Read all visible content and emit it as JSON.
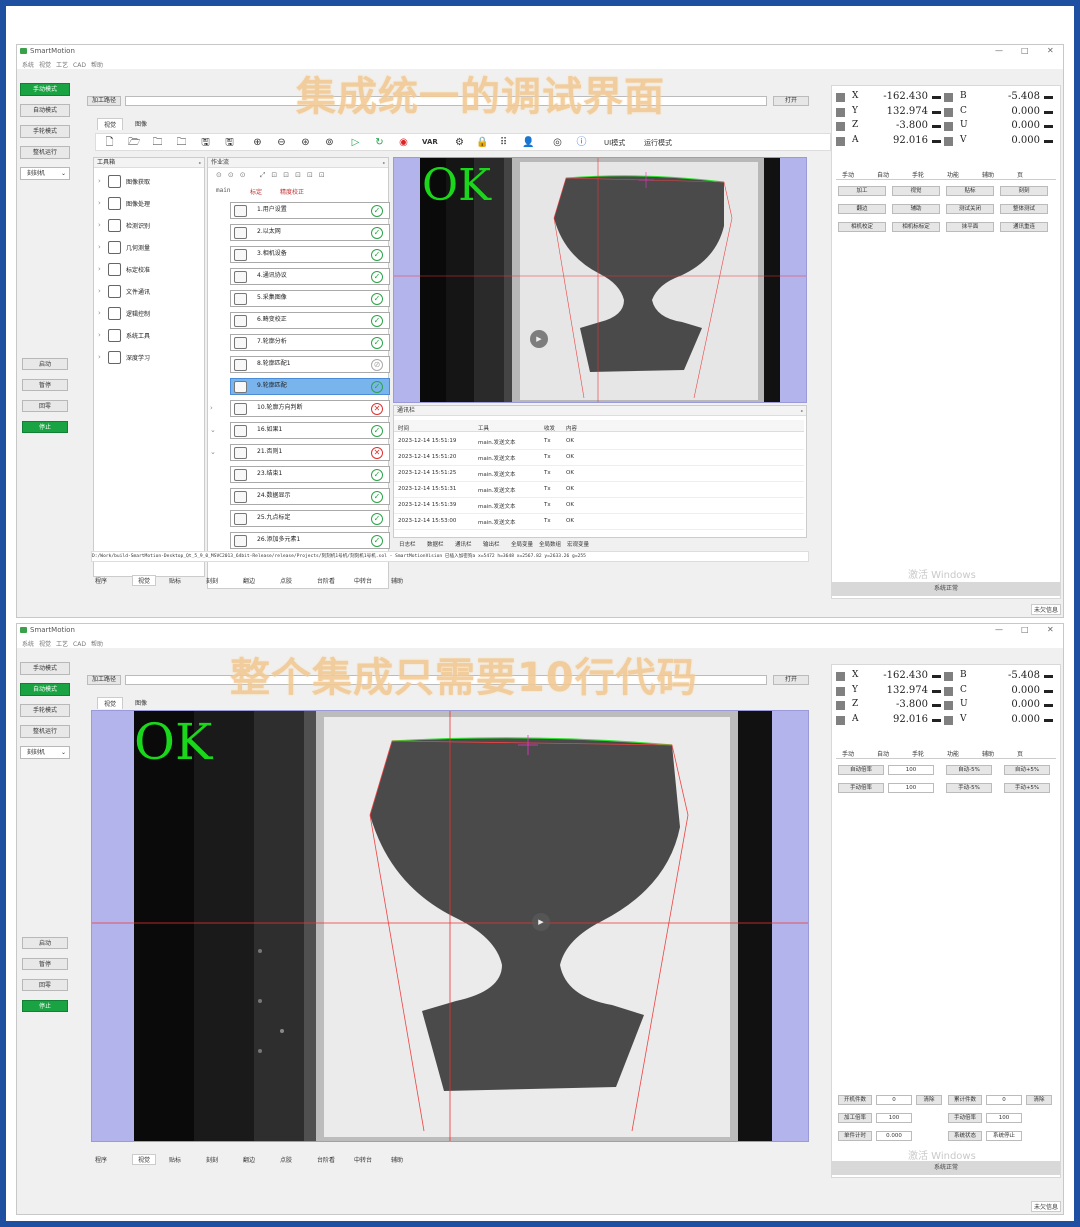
{
  "app": {
    "title": "SmartMotion",
    "controls": [
      "—",
      "□",
      "✕"
    ]
  },
  "menu": [
    "系统",
    "视觉",
    "工艺",
    "CAD",
    "帮助"
  ],
  "banners": [
    "集成统一的调试界面",
    "整个集成只需要10行代码"
  ],
  "leftbar": {
    "modes": [
      "手动模式",
      "自动模式",
      "手轮模式",
      "整机运行"
    ],
    "machine_select": "刻刻机",
    "actions": [
      "启动",
      "暂停",
      "回零",
      "停止"
    ]
  },
  "path_row": {
    "label": "加工路径",
    "value": "",
    "open_button": "打开"
  },
  "view_tabs": [
    "视觉",
    "图像"
  ],
  "toolbar": {
    "icons": [
      "new-icon",
      "open-icon",
      "open-folder-icon",
      "open-recent-icon",
      "save-icon",
      "save-as-icon",
      "zoom-in-icon",
      "zoom-out-icon",
      "zoom-fit-icon",
      "zoom-reset-icon",
      "run-once-icon",
      "run-loop-icon",
      "stop-icon"
    ],
    "var_label": "VAR",
    "icons2": [
      "settings-icon",
      "lock-icon",
      "grid-icon",
      "user-icon",
      "camera-icon",
      "info-icon"
    ],
    "ui_mode": "UI模式",
    "run_mode": "运行模式"
  },
  "toolbox": {
    "title": "工具箱",
    "items": [
      "图像获取",
      "图像处理",
      "检测识别",
      "几何测量",
      "标定校准",
      "文件通讯",
      "逻辑控制",
      "系统工具",
      "深度学习"
    ]
  },
  "flow": {
    "title": "作业流",
    "tabs": [
      "main",
      "标定",
      "精度校正"
    ],
    "items": [
      {
        "label": "1.用户设置",
        "icon": "user-set-icon",
        "status": "ok"
      },
      {
        "label": "2.以太网",
        "icon": "ethernet-icon",
        "status": "ok"
      },
      {
        "label": "3.相机设备",
        "icon": "camera-device-icon",
        "status": "ok"
      },
      {
        "label": "4.通讯协议",
        "icon": "protocol-icon",
        "status": "ok"
      },
      {
        "label": "5.采集图像",
        "icon": "capture-icon",
        "status": "ok"
      },
      {
        "label": "6.畸变校正",
        "icon": "distortion-icon",
        "status": "ok"
      },
      {
        "label": "7.轮廓分析",
        "icon": "contour-icon",
        "status": "ok"
      },
      {
        "label": "8.轮廓匹配1",
        "icon": "match-icon",
        "status": "off"
      },
      {
        "label": "9.轮廓匹配",
        "icon": "match-icon",
        "status": "ok"
      },
      {
        "label": "10.轮廓方向判断",
        "icon": "folder-icon",
        "status": "err"
      },
      {
        "label": "16.如果1",
        "icon": "if-icon",
        "status": "ok"
      },
      {
        "label": "21.否则1",
        "icon": "else-icon",
        "status": "err"
      },
      {
        "label": "23.结束1",
        "icon": "end-icon",
        "status": "ok"
      },
      {
        "label": "24.数据显示",
        "icon": "data-icon",
        "status": "ok"
      },
      {
        "label": "25.九点标定",
        "icon": "ninepoint-icon",
        "status": "ok"
      },
      {
        "label": "26.添加多元素1",
        "icon": "add-icon",
        "status": "ok"
      }
    ]
  },
  "ok_text": "OK",
  "log": {
    "title": "通讯栏",
    "headers": [
      "时间",
      "工具",
      "收发",
      "内容"
    ],
    "rows": [
      [
        "2023-12-14 15:51:19",
        "main.发送文本",
        "Tx",
        "OK"
      ],
      [
        "2023-12-14 15:51:20",
        "main.发送文本",
        "Tx",
        "OK"
      ],
      [
        "2023-12-14 15:51:25",
        "main.发送文本",
        "Tx",
        "OK"
      ],
      [
        "2023-12-14 15:51:31",
        "main.发送文本",
        "Tx",
        "OK"
      ],
      [
        "2023-12-14 15:51:39",
        "main.发送文本",
        "Tx",
        "OK"
      ],
      [
        "2023-12-14 15:53:00",
        "main.发送文本",
        "Tx",
        "OK"
      ]
    ],
    "tabs": [
      "日志栏",
      "数据栏",
      "通讯栏",
      "输出栏",
      "全局变量",
      "全局数组",
      "宏观变量"
    ]
  },
  "statusline": "D:/Work/build-SmartMotion-Desktop_Qt_5_9_0_MSVC2013_64bit-Release/release/Projects/刻刻机1号机/刻刻机1号机.sol - SmartMotionVision  已插入加密狗a  x=5472  h=3648  x=2567.82  y=2633.26  g=255",
  "bottom_tabs": [
    "程序",
    "视觉",
    "贴标",
    "刻刻",
    "翻边",
    "点胶",
    "台阶看",
    "中转台",
    "辅助"
  ],
  "axes": [
    {
      "name": "X",
      "value": "-162.430",
      "name2": "B",
      "value2": "-5.408"
    },
    {
      "name": "Y",
      "value": "132.974",
      "name2": "C",
      "value2": "0.000"
    },
    {
      "name": "Z",
      "value": "-3.800",
      "name2": "U",
      "value2": "0.000"
    },
    {
      "name": "A",
      "value": "92.016",
      "name2": "V",
      "value2": "0.000"
    }
  ],
  "right_tabs": [
    "手动",
    "自动",
    "手轮",
    "功能",
    "辅助",
    "页"
  ],
  "right_buttons_1": [
    "加工",
    "视觉",
    "贴标",
    "刻刻",
    "翻边",
    "辅助",
    "测试关闭",
    "整体测试",
    "相机校定",
    "相机标标定",
    "抹平面",
    "通讯重连"
  ],
  "right_rows_2": [
    {
      "label": "自动倍率",
      "value": "100",
      "btn1": "自动-5%",
      "btn2": "自动+5%"
    },
    {
      "label": "手动倍率",
      "value": "100",
      "btn1": "手动-5%",
      "btn2": "手动+5%"
    }
  ],
  "counters": [
    {
      "label": "开机件数",
      "value": "0",
      "btn": "清除",
      "label2": "累计件数",
      "value2": "0",
      "btn2": "清除"
    },
    {
      "label": "加工倍率",
      "value": "100",
      "label2": "手动倍率",
      "value2": "100"
    },
    {
      "label": "单件计时",
      "value": "0.000",
      "label2": "系统状态",
      "value2": "系统停止"
    }
  ],
  "right_status": "系统正常",
  "watermark": "激活 Windows",
  "corner": "未欠信息",
  "colors": {
    "green": "#19a342",
    "accent_blue": "#1f4fa0",
    "ok_green": "#1bd71b",
    "view_bg": "#b4b4ec"
  }
}
